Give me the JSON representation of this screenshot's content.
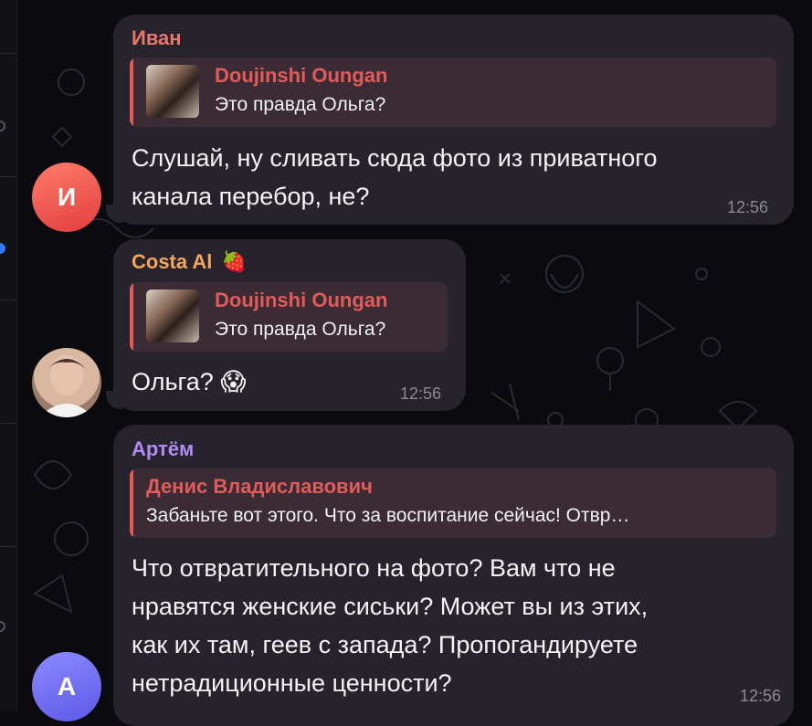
{
  "messages": [
    {
      "sender": "Иван",
      "sender_color": "#e8776c",
      "avatar_letter": "И",
      "reply": {
        "author": "Doujinshi Oungan",
        "text": "Это правда Ольга?"
      },
      "text_lines": [
        "Слушай, ну сливать сюда фото из приватного",
        "канала перебор, не?"
      ],
      "time": "12:56"
    },
    {
      "sender": "Costa Al",
      "sender_emoji": "🍓",
      "sender_color": "#f4a65a",
      "reply": {
        "author": "Doujinshi Oungan",
        "text": "Это правда Ольга?"
      },
      "text": "Ольга?",
      "emoji": "😱",
      "time": "12:56"
    },
    {
      "sender": "Артём",
      "sender_color": "#b08cf5",
      "avatar_letter": "А",
      "reply": {
        "author": "Денис Владиславович",
        "text": "Забаньте вот этого. Что за воспитание сейчас! Отвр…"
      },
      "text_lines": [
        "Что отвратительного на фото? Вам что не",
        "нравятся женские сиськи? Может вы из этих,",
        "как их там, геев с запада? Пропогандируете",
        "нетрадиционные ценности?"
      ],
      "time": "12:56"
    }
  ]
}
